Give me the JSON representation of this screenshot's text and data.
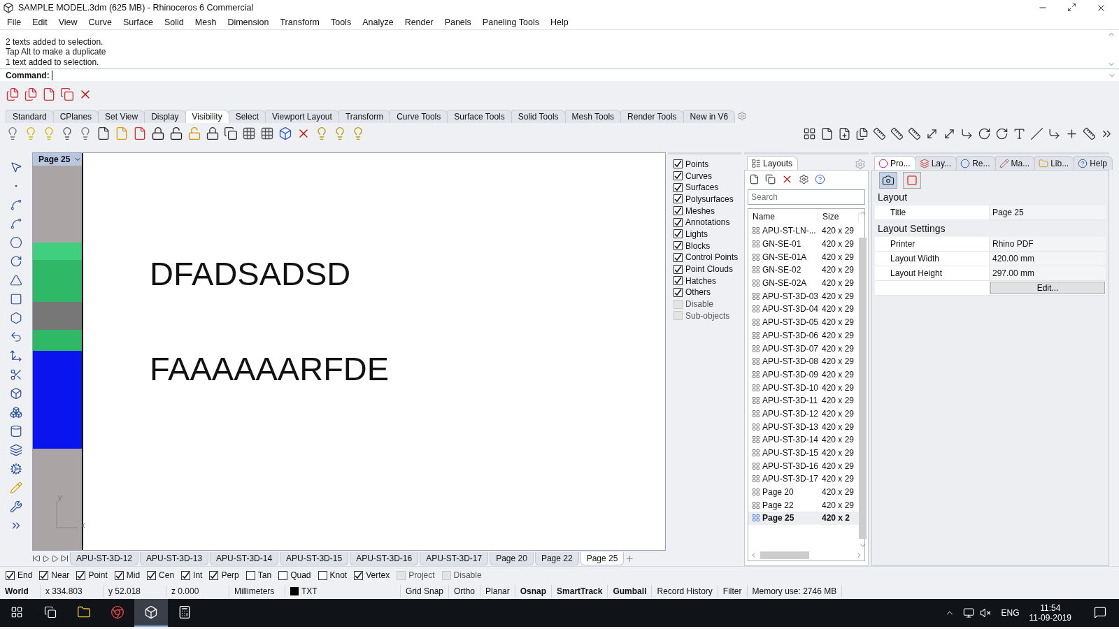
{
  "window": {
    "title": "SAMPLE MODEL.3dm (625 MB) - Rhinoceros 6 Commercial"
  },
  "menu": [
    "File",
    "Edit",
    "View",
    "Curve",
    "Surface",
    "Solid",
    "Mesh",
    "Dimension",
    "Transform",
    "Tools",
    "Analyze",
    "Render",
    "Panels",
    "Paneling Tools",
    "Help"
  ],
  "command_history": [
    "2 texts added to selection.",
    "Tap Alt to make a duplicate",
    "1 text added to selection."
  ],
  "command": {
    "label": "Command:"
  },
  "toolbar_tabs": [
    {
      "label": "Standard",
      "selected": false
    },
    {
      "label": "CPlanes",
      "selected": false
    },
    {
      "label": "Set View",
      "selected": false
    },
    {
      "label": "Display",
      "selected": false
    },
    {
      "label": "Visibility",
      "selected": true
    },
    {
      "label": "Select",
      "selected": false
    },
    {
      "label": "Viewport Layout",
      "selected": false
    },
    {
      "label": "Transform",
      "selected": false
    },
    {
      "label": "Curve Tools",
      "selected": false
    },
    {
      "label": "Surface Tools",
      "selected": false
    },
    {
      "label": "Solid Tools",
      "selected": false
    },
    {
      "label": "Mesh Tools",
      "selected": false
    },
    {
      "label": "Render Tools",
      "selected": false
    },
    {
      "label": "New in V6",
      "selected": false
    }
  ],
  "viewport": {
    "title": "Page 25",
    "texts": [
      "DFADSADSD",
      "FAAAAAARFDE"
    ],
    "axis_labels": [
      "y",
      "x"
    ]
  },
  "visibility": [
    {
      "label": "Points",
      "checked": true,
      "disabled": false
    },
    {
      "label": "Curves",
      "checked": true,
      "disabled": false
    },
    {
      "label": "Surfaces",
      "checked": true,
      "disabled": false
    },
    {
      "label": "Polysurfaces",
      "checked": true,
      "disabled": false
    },
    {
      "label": "Meshes",
      "checked": true,
      "disabled": false
    },
    {
      "label": "Annotations",
      "checked": true,
      "disabled": false
    },
    {
      "label": "Lights",
      "checked": true,
      "disabled": false
    },
    {
      "label": "Blocks",
      "checked": true,
      "disabled": false
    },
    {
      "label": "Control Points",
      "checked": true,
      "disabled": false
    },
    {
      "label": "Point Clouds",
      "checked": true,
      "disabled": false
    },
    {
      "label": "Hatches",
      "checked": true,
      "disabled": false
    },
    {
      "label": "Others",
      "checked": true,
      "disabled": false
    },
    {
      "label": "Disable",
      "checked": false,
      "disabled": true
    },
    {
      "label": "Sub-objects",
      "checked": false,
      "disabled": true
    }
  ],
  "layouts": {
    "title": "Layouts",
    "search": {
      "placeholder": "Search"
    },
    "columns": [
      "Name",
      "Size"
    ],
    "rows": [
      {
        "name": "APU-ST-LN-...",
        "size": "420 x 29",
        "selected": false
      },
      {
        "name": "GN-SE-01",
        "size": "420 x 29",
        "selected": false
      },
      {
        "name": "GN-SE-01A",
        "size": "420 x 29",
        "selected": false
      },
      {
        "name": "GN-SE-02",
        "size": "420 x 29",
        "selected": false
      },
      {
        "name": "GN-SE-02A",
        "size": "420 x 29",
        "selected": false
      },
      {
        "name": "APU-ST-3D-03",
        "size": "420 x 29",
        "selected": false
      },
      {
        "name": "APU-ST-3D-04",
        "size": "420 x 29",
        "selected": false
      },
      {
        "name": "APU-ST-3D-05",
        "size": "420 x 29",
        "selected": false
      },
      {
        "name": "APU-ST-3D-06",
        "size": "420 x 29",
        "selected": false
      },
      {
        "name": "APU-ST-3D-07",
        "size": "420 x 29",
        "selected": false
      },
      {
        "name": "APU-ST-3D-08",
        "size": "420 x 29",
        "selected": false
      },
      {
        "name": "APU-ST-3D-09",
        "size": "420 x 29",
        "selected": false
      },
      {
        "name": "APU-ST-3D-10",
        "size": "420 x 29",
        "selected": false
      },
      {
        "name": "APU-ST-3D-11",
        "size": "420 x 29",
        "selected": false
      },
      {
        "name": "APU-ST-3D-12",
        "size": "420 x 29",
        "selected": false
      },
      {
        "name": "APU-ST-3D-13",
        "size": "420 x 29",
        "selected": false
      },
      {
        "name": "APU-ST-3D-14",
        "size": "420 x 29",
        "selected": false
      },
      {
        "name": "APU-ST-3D-15",
        "size": "420 x 29",
        "selected": false
      },
      {
        "name": "APU-ST-3D-16",
        "size": "420 x 29",
        "selected": false
      },
      {
        "name": "APU-ST-3D-17",
        "size": "420 x 29",
        "selected": false
      },
      {
        "name": "Page 20",
        "size": "420 x 29",
        "selected": false
      },
      {
        "name": "Page 22",
        "size": "420 x 29",
        "selected": false
      },
      {
        "name": "Page 25",
        "size": "420 x 2",
        "selected": true
      }
    ]
  },
  "properties": {
    "tabs": [
      {
        "label": "Pro...",
        "selected": true
      },
      {
        "label": "Lay...",
        "selected": false
      },
      {
        "label": "Re...",
        "selected": false
      },
      {
        "label": "Ma...",
        "selected": false
      },
      {
        "label": "Lib...",
        "selected": false
      },
      {
        "label": "Help",
        "selected": false
      }
    ],
    "sections": [
      {
        "title": "Layout",
        "rows": [
          {
            "label": "Title",
            "value": "Page 25"
          }
        ]
      },
      {
        "title": "Layout Settings",
        "rows": [
          {
            "label": "Printer",
            "value": "Rhino PDF"
          },
          {
            "label": "Layout Width",
            "value": "420.00 mm"
          },
          {
            "label": "Layout Height",
            "value": "297.00 mm"
          }
        ]
      }
    ],
    "edit_button": "Edit..."
  },
  "layout_tabs": [
    {
      "label": "APU-ST-3D-12",
      "selected": false
    },
    {
      "label": "APU-ST-3D-13",
      "selected": false
    },
    {
      "label": "APU-ST-3D-14",
      "selected": false
    },
    {
      "label": "APU-ST-3D-15",
      "selected": false
    },
    {
      "label": "APU-ST-3D-16",
      "selected": false
    },
    {
      "label": "APU-ST-3D-17",
      "selected": false
    },
    {
      "label": "Page 20",
      "selected": false
    },
    {
      "label": "Page 22",
      "selected": false
    },
    {
      "label": "Page 25",
      "selected": true
    }
  ],
  "osnaps": [
    {
      "label": "End",
      "checked": true,
      "disabled": false
    },
    {
      "label": "Near",
      "checked": true,
      "disabled": false
    },
    {
      "label": "Point",
      "checked": true,
      "disabled": false
    },
    {
      "label": "Mid",
      "checked": true,
      "disabled": false
    },
    {
      "label": "Cen",
      "checked": true,
      "disabled": false
    },
    {
      "label": "Int",
      "checked": true,
      "disabled": false
    },
    {
      "label": "Perp",
      "checked": true,
      "disabled": false
    },
    {
      "label": "Tan",
      "checked": false,
      "disabled": false
    },
    {
      "label": "Quad",
      "checked": false,
      "disabled": false
    },
    {
      "label": "Knot",
      "checked": false,
      "disabled": false
    },
    {
      "label": "Vertex",
      "checked": true,
      "disabled": false
    },
    {
      "label": "Project",
      "checked": false,
      "disabled": true
    },
    {
      "label": "Disable",
      "checked": false,
      "disabled": true
    }
  ],
  "status_bar": {
    "cplane": "World",
    "x": "x 334.803",
    "y": "y 52.018",
    "z": "z 0.000",
    "units": "Millimeters",
    "layer": "TXT",
    "toggles": [
      {
        "label": "Grid Snap",
        "on": false
      },
      {
        "label": "Ortho",
        "on": false
      },
      {
        "label": "Planar",
        "on": false
      },
      {
        "label": "Osnap",
        "on": true
      },
      {
        "label": "SmartTrack",
        "on": true
      },
      {
        "label": "Gumball",
        "on": true
      },
      {
        "label": "Record History",
        "on": false
      },
      {
        "label": "Filter",
        "on": false
      }
    ],
    "memory": "Memory use: 2746 MB"
  },
  "taskbar": {
    "language": "ENG",
    "time": "11:54",
    "date": "11-09-2019"
  }
}
